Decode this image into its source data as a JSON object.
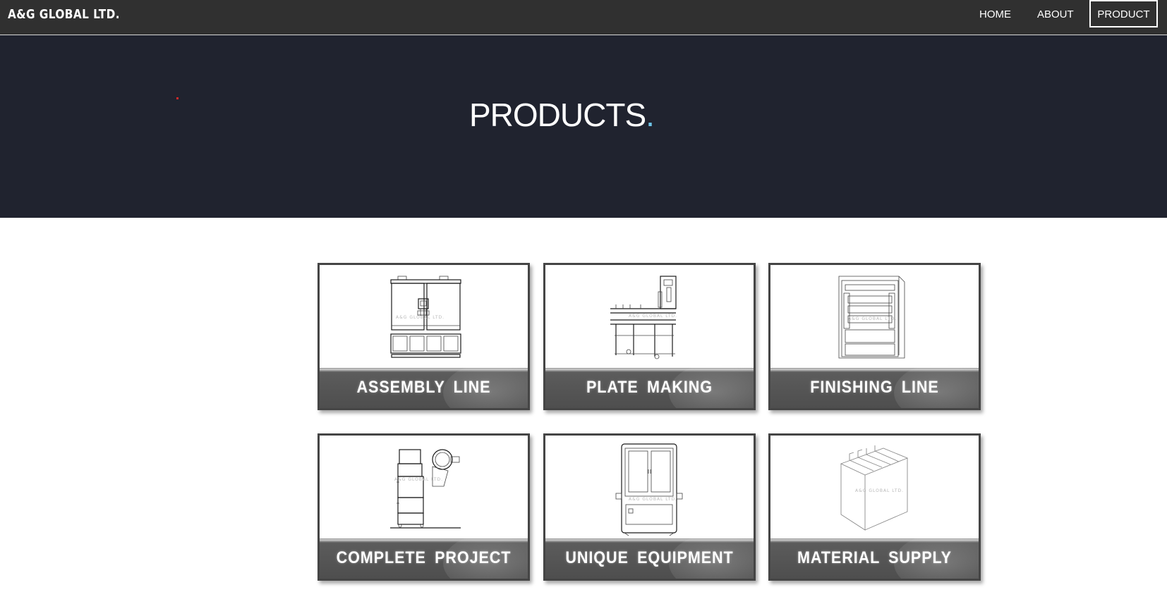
{
  "nav": {
    "brand": "A&G GLOBAL LTD.",
    "items": [
      {
        "label": "HOME"
      },
      {
        "label": "ABOUT"
      },
      {
        "label": "PRODUCT",
        "active": true
      }
    ]
  },
  "hero": {
    "title": "PRODUCTS",
    "title_accent": ".",
    "background_color": "#20232f",
    "accent_color": "#6ec4e8"
  },
  "products": [
    {
      "label": "ASSEMBLY LINE",
      "icon": "assembly-line-machine-drawing"
    },
    {
      "label": "PLATE MAKING",
      "icon": "plate-making-machine-drawing"
    },
    {
      "label": "FINISHING LINE",
      "icon": "finishing-line-cabinet-drawing"
    },
    {
      "label": "COMPLETE PROJECT",
      "icon": "complete-project-machine-drawing"
    },
    {
      "label": "UNIQUE EQUIPMENT",
      "icon": "unique-equipment-cabinet-drawing"
    },
    {
      "label": "MATERIAL SUPPLY",
      "icon": "material-supply-bin-drawing"
    }
  ],
  "watermark": "A&G GLOBAL LTD."
}
